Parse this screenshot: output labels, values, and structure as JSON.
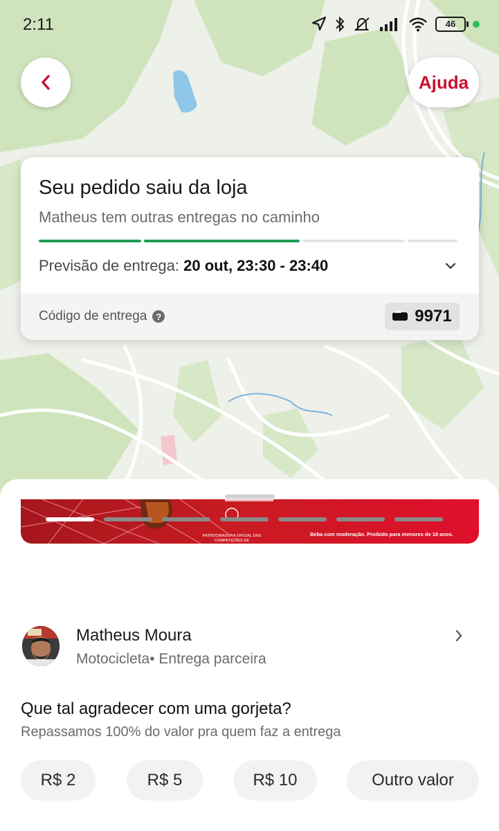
{
  "status_bar": {
    "time": "2:11",
    "battery_level": "46",
    "icons": [
      "location-arrow-icon",
      "bluetooth-icon",
      "mute-icon",
      "signal-icon",
      "wifi-icon",
      "battery-icon",
      "status-dot-icon"
    ]
  },
  "header": {
    "back_icon": "chevron-left-icon",
    "help_label": "Ajuda"
  },
  "order_card": {
    "title": "Seu pedido saiu da loja",
    "subtitle": "Matheus tem outras entregas no caminho",
    "progress": {
      "total_steps": 4,
      "completed_steps": 2
    },
    "eta_label": "Previsão de entrega:",
    "eta_value": "20 out, 23:30 - 23:40",
    "code_label": "Código de entrega",
    "code_value": "9971"
  },
  "banner": {
    "disclaimer": "Beba com moderação. Proibido para menores de 18 anos.",
    "sponsor_text": "PATROCINADORA OFICIAL DAS COMPETIÇÕES DE",
    "carousel": {
      "count": 7,
      "active_index": 0
    }
  },
  "courier": {
    "name": "Matheus Moura",
    "vehicle": "Motocicleta",
    "separator": "•",
    "type": "Entrega parceira"
  },
  "tip_section": {
    "title": "Que tal agradecer com uma gorjeta?",
    "subtitle": "Repassamos 100% do valor pra quem faz a entrega",
    "options": [
      "R$ 2",
      "R$ 5",
      "R$ 10",
      "Outro valor"
    ]
  },
  "colors": {
    "brand": "#c8102e",
    "progress_done": "#1f9d55",
    "progress_pending": "#e3e3e3"
  }
}
